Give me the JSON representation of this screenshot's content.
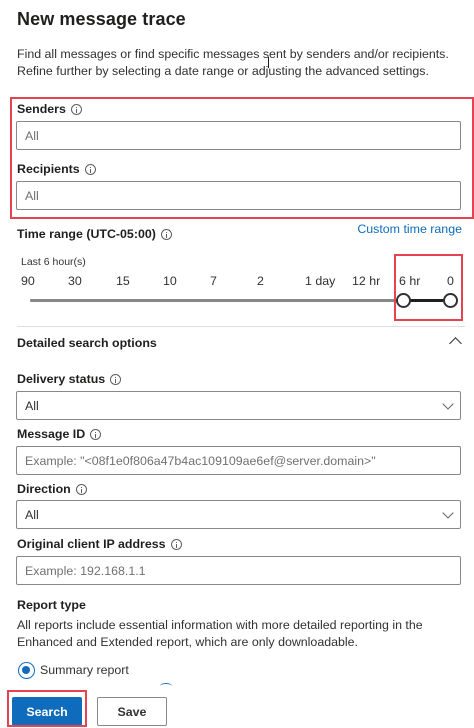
{
  "title": "New message trace",
  "description": "Find all messages or find specific messages sent by senders and/or recipients. Refine further by selecting a date range or adjusting the advanced settings.",
  "senders": {
    "label": "Senders",
    "placeholder": "All"
  },
  "recipients": {
    "label": "Recipients",
    "placeholder": "All"
  },
  "time_range": {
    "label": "Time range (UTC-05:00)",
    "custom_link": "Custom time range",
    "note": "Last 6 hour(s)",
    "ticks": [
      "90",
      "30",
      "15",
      "10",
      "7",
      "2",
      "1 day",
      "12 hr",
      "6 hr",
      "0"
    ],
    "selected_start": "6 hr",
    "selected_end": "0"
  },
  "detailed": {
    "title": "Detailed search options",
    "delivery_status": {
      "label": "Delivery status",
      "value": "All"
    },
    "message_id": {
      "label": "Message ID",
      "placeholder": "Example: \"<08f1e0f806a47b4ac109109ae6ef@server.domain>\""
    },
    "direction": {
      "label": "Direction",
      "value": "All"
    },
    "client_ip": {
      "label": "Original client IP address",
      "placeholder": "Example: 192.168.1.1"
    }
  },
  "report_type": {
    "label": "Report type",
    "description": "All reports include essential information with more detailed reporting in the Enhanced and Extended report, which are only downloadable.",
    "selected": "Summary report"
  },
  "buttons": {
    "search": "Search",
    "save": "Save"
  },
  "colors": {
    "accent": "#0f6cbd",
    "highlight": "#e3444f"
  }
}
